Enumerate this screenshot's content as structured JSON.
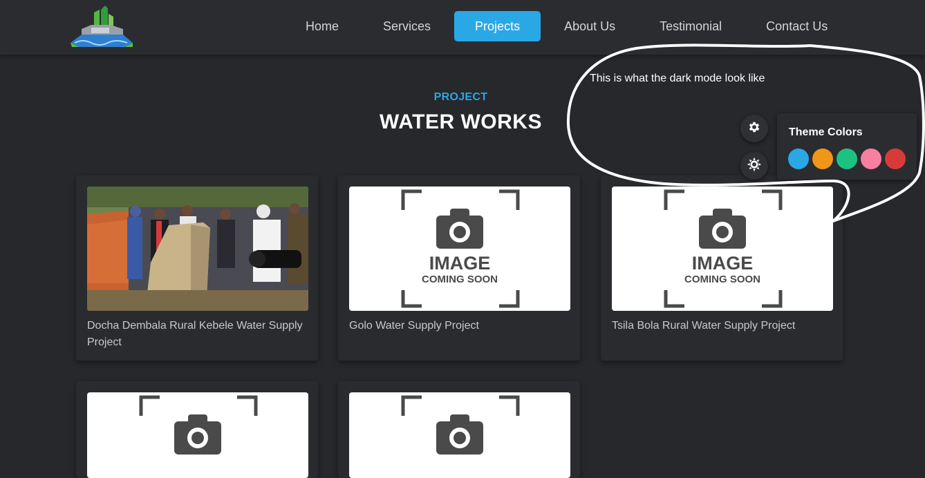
{
  "nav": {
    "items": [
      {
        "label": "Home"
      },
      {
        "label": "Services"
      },
      {
        "label": "Projects",
        "active": true
      },
      {
        "label": "About Us"
      },
      {
        "label": "Testimonial"
      },
      {
        "label": "Contact Us"
      }
    ],
    "accent_color": "#2aa8e6"
  },
  "section": {
    "subtitle": "PROJECT",
    "title": "WATER WORKS"
  },
  "projects": [
    {
      "title": "Docha Dembala Rural Kebele Water Supply Project",
      "image": "photo"
    },
    {
      "title": "Golo Water Supply Project",
      "image": "image-coming-soon"
    },
    {
      "title": "Tsila Bola Rural Water Supply Project",
      "image": "image-coming-soon"
    },
    {
      "title": "",
      "image": "image-coming-soon"
    },
    {
      "title": "",
      "image": "image-coming-soon"
    }
  ],
  "placeholder": {
    "line1": "IMAGE",
    "line2": "COMING SOON"
  },
  "annotation": {
    "text": "This is what the dark mode look like"
  },
  "settings": {
    "buttons": [
      {
        "icon": "gear-icon"
      },
      {
        "icon": "sun-icon"
      }
    ],
    "theme_colors_title": "Theme Colors",
    "theme_colors": [
      "#2aa8e6",
      "#f0961b",
      "#1dc283",
      "#f77fa0",
      "#d83a3a"
    ]
  }
}
